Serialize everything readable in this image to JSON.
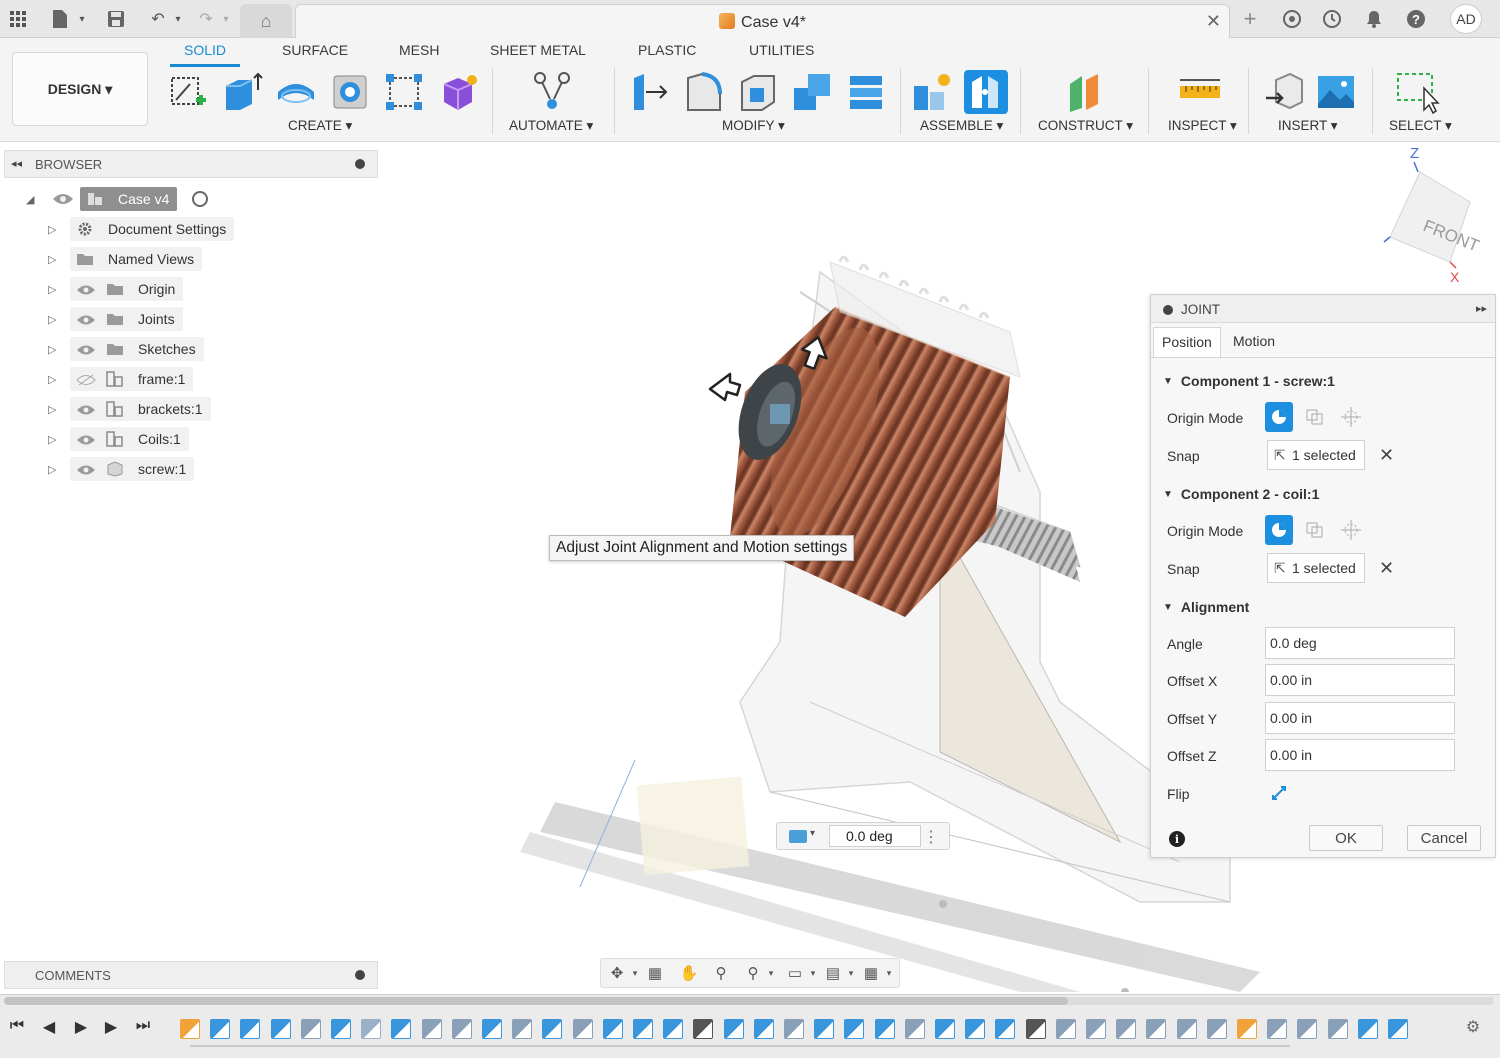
{
  "titlebar": {
    "document_title": "Case v4*",
    "user_initials": "AD"
  },
  "toolbar": {
    "tabs": [
      "SOLID",
      "SURFACE",
      "MESH",
      "SHEET METAL",
      "PLASTIC",
      "UTILITIES"
    ],
    "active_tab": "SOLID",
    "workspace": "DESIGN ▾",
    "groups": {
      "create": "CREATE ▾",
      "automate": "AUTOMATE ▾",
      "modify": "MODIFY ▾",
      "assemble": "ASSEMBLE ▾",
      "construct": "CONSTRUCT ▾",
      "inspect": "INSPECT ▾",
      "insert": "INSERT ▾",
      "select": "SELECT ▾"
    }
  },
  "browser": {
    "title": "BROWSER",
    "root": "Case v4",
    "items": [
      {
        "label": "Document Settings",
        "icon": "gear-icon",
        "visible": null
      },
      {
        "label": "Named Views",
        "icon": "folder-icon",
        "visible": null
      },
      {
        "label": "Origin",
        "icon": "folder-icon",
        "visible": true
      },
      {
        "label": "Joints",
        "icon": "folder-icon",
        "visible": true
      },
      {
        "label": "Sketches",
        "icon": "folder-icon",
        "visible": true
      },
      {
        "label": "frame:1",
        "icon": "component-icon",
        "visible": false
      },
      {
        "label": "brackets:1",
        "icon": "component-icon",
        "visible": true
      },
      {
        "label": "Coils:1",
        "icon": "component-icon",
        "visible": true
      },
      {
        "label": "screw:1",
        "icon": "body-icon",
        "visible": true
      }
    ]
  },
  "comments": {
    "title": "COMMENTS"
  },
  "viewport": {
    "tooltip": "Adjust Joint Alignment and Motion settings",
    "angle_value": "0.0 deg",
    "viewcube_face": "FRONT",
    "axis_z": "Z",
    "axis_x": "X"
  },
  "joint_dialog": {
    "title": "JOINT",
    "tabs": [
      "Position",
      "Motion"
    ],
    "component1": "Component 1 - screw:1",
    "component2": "Component 2 - coil:1",
    "origin_mode_label": "Origin Mode",
    "snap_label": "Snap",
    "snap1_value": "1 selected",
    "snap2_value": "1 selected",
    "alignment": "Alignment",
    "fields": [
      {
        "label": "Angle",
        "value": "0.0 deg"
      },
      {
        "label": "Offset X",
        "value": "0.00 in"
      },
      {
        "label": "Offset Y",
        "value": "0.00 in"
      },
      {
        "label": "Offset Z",
        "value": "0.00 in"
      }
    ],
    "flip_label": "Flip",
    "ok": "OK",
    "cancel": "Cancel"
  },
  "colors": {
    "accent": "#1b8ad3",
    "coil": "#b06a4c",
    "panel_bg": "#f7f7f7"
  }
}
